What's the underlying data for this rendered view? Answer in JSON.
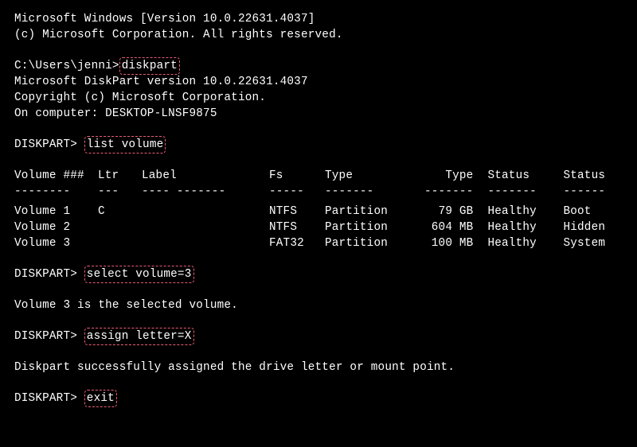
{
  "header": {
    "line1": "Microsoft Windows [Version 10.0.22631.4037]",
    "line2": "(c) Microsoft Corporation. All rights reserved."
  },
  "prompt1": {
    "prefix": "C:\\Users\\jenni>",
    "cmd": "diskpart"
  },
  "diskpart_info": {
    "line1": "Microsoft DiskPart version 10.0.22631.4037",
    "line2": "Copyright (c) Microsoft Corporation.",
    "line3": "On computer: DESKTOP-LNSF9875"
  },
  "prompt2": {
    "prefix": "DISKPART> ",
    "cmd": "list volume"
  },
  "table": {
    "headers": {
      "col0": "Volume ###",
      "col1": "Ltr",
      "col2": "Label",
      "col3": "Fs",
      "col4": "Type",
      "col5": "Type",
      "col6": "Status",
      "col7": "Status"
    },
    "dashes": {
      "col0": "--------",
      "col1": "---",
      "col2": "---- -------",
      "col3": "-----",
      "col4": "-------",
      "col5": "-------",
      "col6": "-------",
      "col7": "------"
    },
    "rows": [
      {
        "col0": "Volume 1",
        "col1": "C",
        "col2": "",
        "col3": "NTFS",
        "col4": "Partition",
        "col5": "79 GB",
        "col6": "Healthy",
        "col7": "Boot"
      },
      {
        "col0": "Volume 2",
        "col1": "",
        "col2": "",
        "col3": "NTFS",
        "col4": "Partition",
        "col5": "604 MB",
        "col6": "Healthy",
        "col7": "Hidden"
      },
      {
        "col0": "Volume 3",
        "col1": "",
        "col2": "",
        "col3": "FAT32",
        "col4": "Partition",
        "col5": "100 MB",
        "col6": "Healthy",
        "col7": "System"
      }
    ]
  },
  "prompt3": {
    "prefix": "DISKPART> ",
    "cmd": "select volume=3"
  },
  "response3": "Volume 3 is the selected volume.",
  "prompt4": {
    "prefix": "DISKPART> ",
    "cmd": "assign letter=X"
  },
  "response4": "Diskpart successfully assigned the drive letter or mount point.",
  "prompt5": {
    "prefix": "DISKPART> ",
    "cmd": "exit"
  }
}
